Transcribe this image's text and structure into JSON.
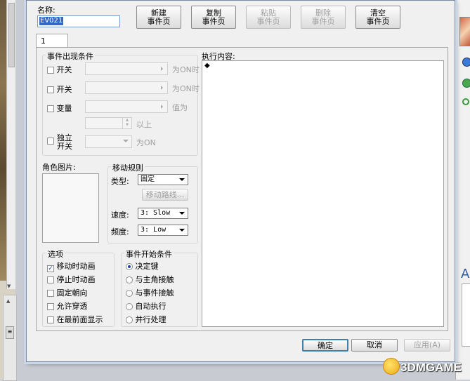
{
  "header": {
    "name_label": "名称:",
    "name_value": "EV021"
  },
  "toolbar": {
    "new_page": "新建\n事件页",
    "copy_page": "复制\n事件页",
    "paste_page": "粘贴\n事件页",
    "delete_page": "删除\n事件页",
    "clear_page": "清空\n事件页"
  },
  "tabs": [
    {
      "label": "1"
    }
  ],
  "conditions": {
    "title": "事件出现条件",
    "switch1": {
      "label": "开关",
      "suffix": "为ON时"
    },
    "switch2": {
      "label": "开关",
      "suffix": "为ON时"
    },
    "variable": {
      "label": "变量",
      "suffix": "值为",
      "above": "以上"
    },
    "self_switch": {
      "label": "独立\n开关",
      "suffix": "为ON"
    }
  },
  "image": {
    "label": "角色图片:"
  },
  "movement": {
    "title": "移动规则",
    "type_label": "类型:",
    "type_value": "固定",
    "route_button": "移动路线...",
    "speed_label": "速度:",
    "speed_value": "3: Slow",
    "freq_label": "频度:",
    "freq_value": "3: Low"
  },
  "options": {
    "title": "选项",
    "items": [
      {
        "label": "移动时动画",
        "checked": true
      },
      {
        "label": "停止时动画",
        "checked": false
      },
      {
        "label": "固定朝向",
        "checked": false
      },
      {
        "label": "允许穿透",
        "checked": false
      },
      {
        "label": "在最前面显示",
        "checked": false
      }
    ]
  },
  "trigger": {
    "title": "事件开始条件",
    "items": [
      {
        "label": "决定键",
        "selected": true
      },
      {
        "label": "与主角接触",
        "selected": false
      },
      {
        "label": "与事件接触",
        "selected": false
      },
      {
        "label": "自动执行",
        "selected": false
      },
      {
        "label": "并行处理",
        "selected": false
      }
    ]
  },
  "contents": {
    "label": "执行内容:",
    "first_item": "◆"
  },
  "footer": {
    "ok": "确定",
    "cancel": "取消",
    "apply": "应用(A)"
  },
  "watermark": {
    "text": "3DMGAME"
  },
  "colors": {
    "accent": "#1c3fa0",
    "dialog_bg": "#f0f0f0",
    "ok_border": "#3c7fb1"
  }
}
